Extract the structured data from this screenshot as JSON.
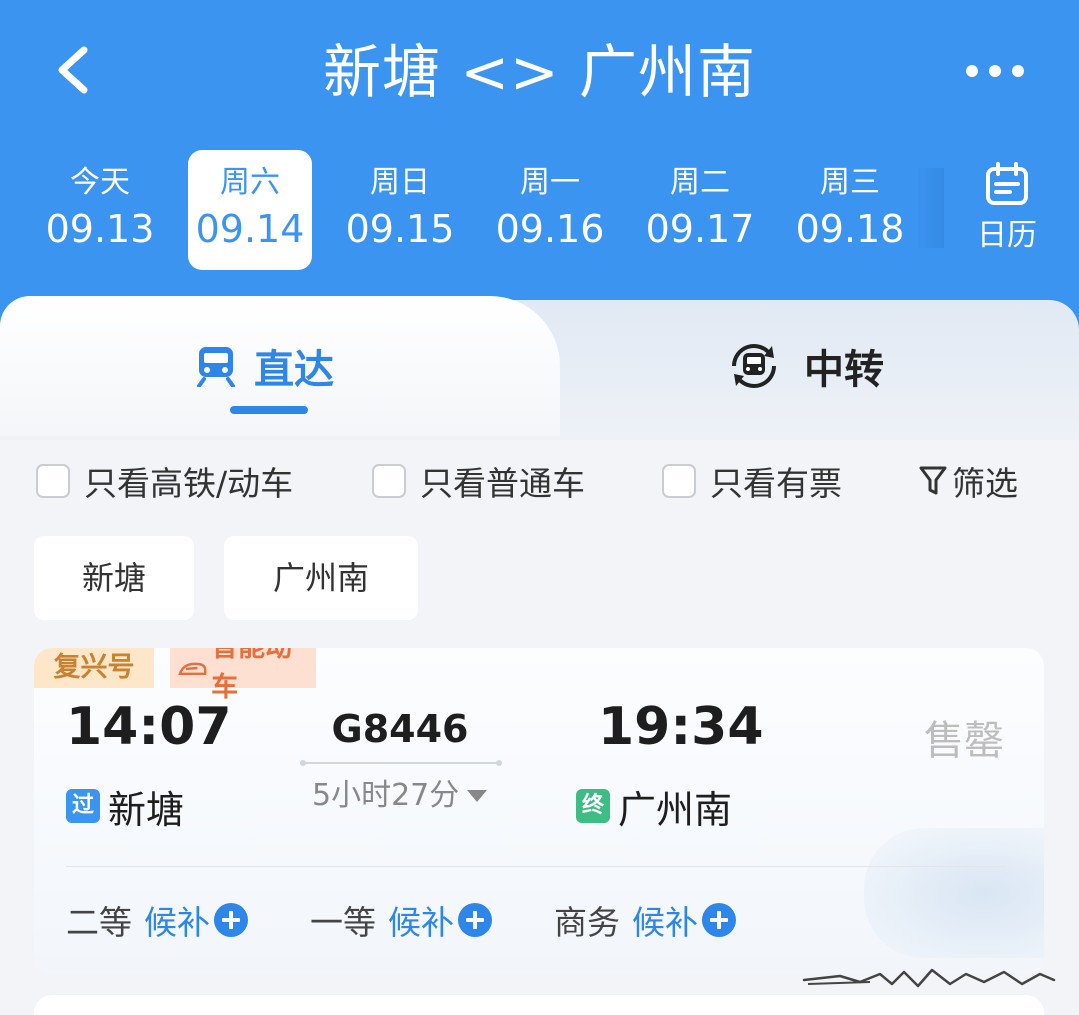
{
  "header": {
    "title": "新塘 <> 广州南"
  },
  "dates": [
    {
      "weekday": "今天",
      "date": "09.13"
    },
    {
      "weekday": "周六",
      "date": "09.14"
    },
    {
      "weekday": "周日",
      "date": "09.15"
    },
    {
      "weekday": "周一",
      "date": "09.16"
    },
    {
      "weekday": "周二",
      "date": "09.17"
    },
    {
      "weekday": "周三",
      "date": "09.18"
    }
  ],
  "selected_date_index": 1,
  "calendar": {
    "label": "日历"
  },
  "tabs": {
    "direct": "直达",
    "transfer": "中转"
  },
  "filters": {
    "high_speed": "只看高铁/动车",
    "normal": "只看普通车",
    "available": "只看有票",
    "filter": "筛选"
  },
  "station_chips": {
    "from": "新塘",
    "to": "广州南"
  },
  "train": {
    "badge_fuxing": "复兴号",
    "badge_smart": "智能动车",
    "depart_time": "14:07",
    "arrive_time": "19:34",
    "number": "G8446",
    "duration": "5小时27分",
    "from_tag": "过",
    "from_station": "新塘",
    "to_tag": "终",
    "to_station": "广州南",
    "status": "售罄",
    "seats": [
      {
        "class": "二等",
        "action": "候补"
      },
      {
        "class": "一等",
        "action": "候补"
      },
      {
        "class": "商务",
        "action": "候补"
      }
    ]
  },
  "colors": {
    "primary": "#3b94f0",
    "accent_blue": "#2d86e8",
    "pass_tag": "#3b94f0",
    "terminal_tag": "#3dbd84",
    "sold_out": "#bdbdbd"
  }
}
